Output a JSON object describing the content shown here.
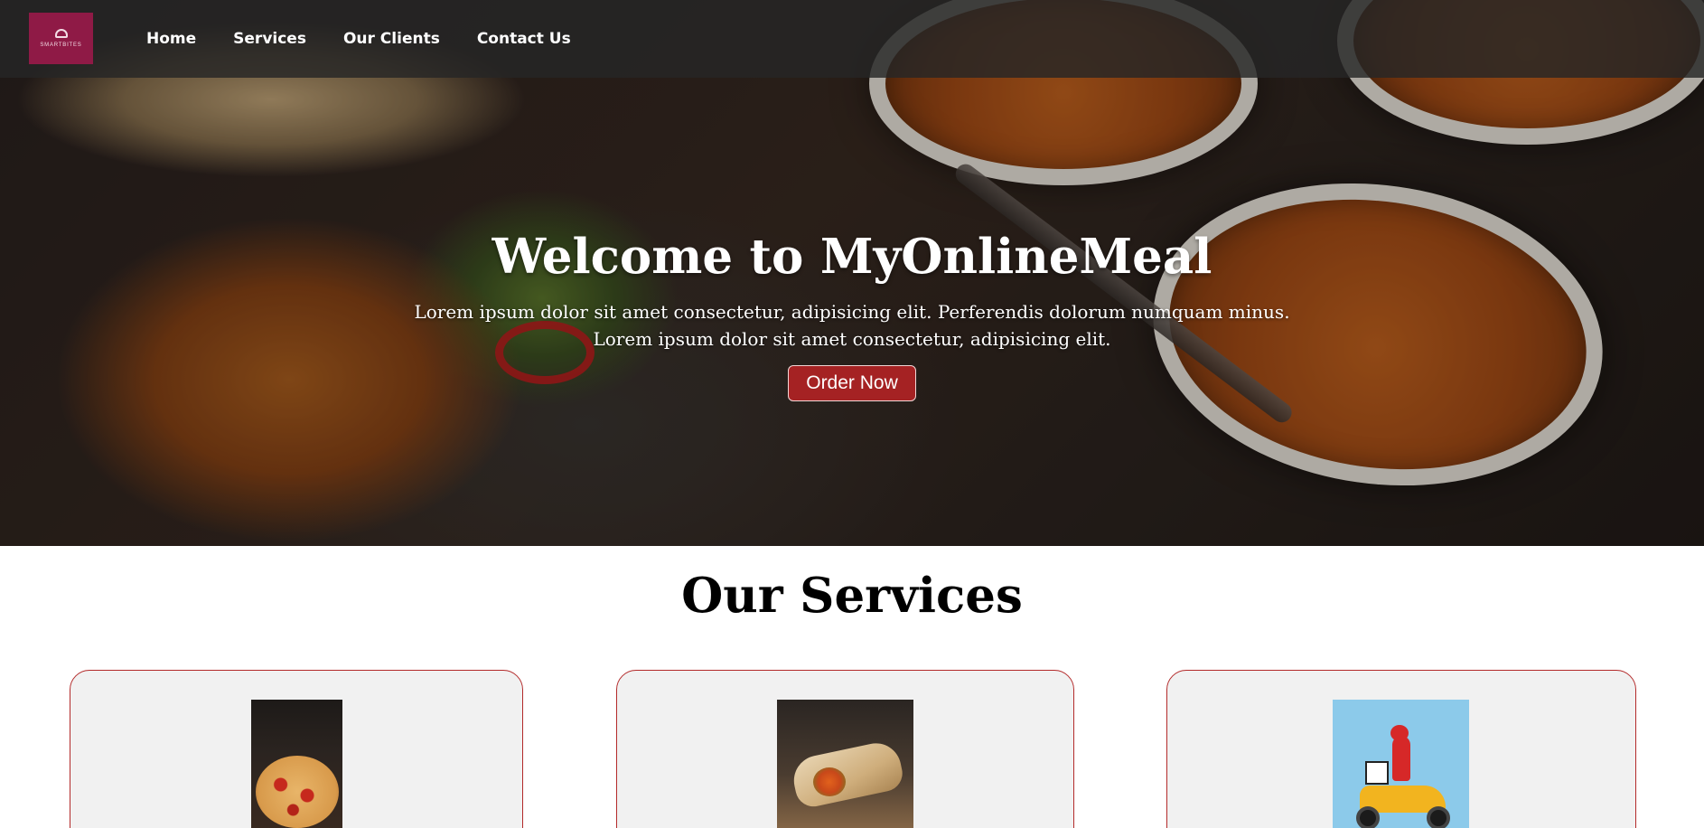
{
  "logo": {
    "text": "SMARTBITES"
  },
  "nav": {
    "links": [
      {
        "label": "Home"
      },
      {
        "label": "Services"
      },
      {
        "label": "Our Clients"
      },
      {
        "label": "Contact Us"
      }
    ]
  },
  "hero": {
    "title": "Welcome to MyOnlineMeal",
    "subtitle_line1": "Lorem ipsum dolor sit amet consectetur, adipisicing elit. Perferendis dolorum numquam minus.",
    "subtitle_line2": "Lorem ipsum dolor sit amet consectetur, adipisicing elit.",
    "cta_label": "Order Now"
  },
  "services": {
    "title": "Our Services",
    "cards": [
      {
        "image": "pizza-image"
      },
      {
        "image": "wrap-image"
      },
      {
        "image": "delivery-scooter-image"
      }
    ]
  },
  "colors": {
    "brand": "#8f1a46",
    "cta": "#a52223",
    "card_border": "#b32a2a",
    "card_bg": "#f1f1f1"
  }
}
